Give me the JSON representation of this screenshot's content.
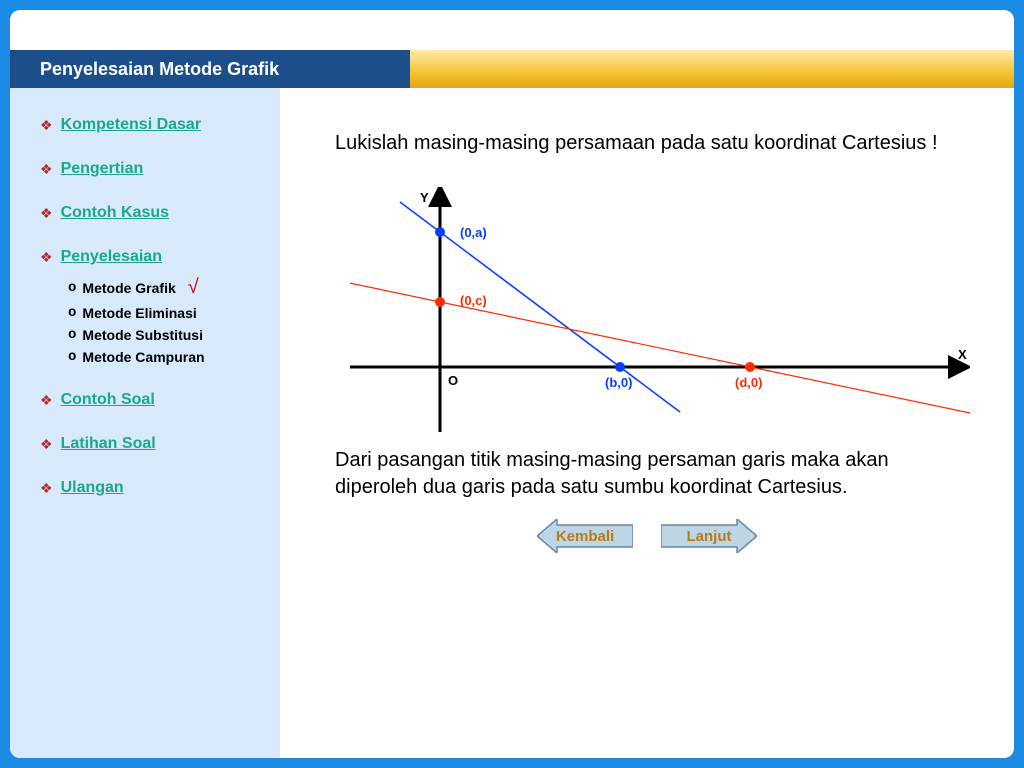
{
  "header": {
    "title": "Penyelesaian Metode Grafik"
  },
  "sidebar": {
    "items": [
      {
        "label": "Kompetensi Dasar"
      },
      {
        "label": "Pengertian"
      },
      {
        "label": "Contoh Kasus"
      },
      {
        "label": "Penyelesaian",
        "sub": [
          {
            "label": "Metode Grafik",
            "active": true
          },
          {
            "label": "Metode Eliminasi"
          },
          {
            "label": "Metode Substitusi"
          },
          {
            "label": "Metode Campuran"
          }
        ]
      },
      {
        "label": "Contoh Soal"
      },
      {
        "label": "Latihan Soal"
      },
      {
        "label": "Ulangan"
      }
    ]
  },
  "main": {
    "lead": "Lukislah masing-masing persamaan pada satu koordinat Cartesius !",
    "body": "Dari pasangan titik masing-masing persaman garis maka akan diperoleh dua garis pada satu sumbu koordinat Cartesius."
  },
  "buttons": {
    "back": "Kembali",
    "next": "Lanjut"
  },
  "chart_data": {
    "type": "line",
    "title": "",
    "xlabel": "X",
    "ylabel": "Y",
    "origin_label": "O",
    "series": [
      {
        "name": "line1",
        "color": "#0a3cff",
        "points": [
          {
            "label": "(0,a)",
            "x": 0,
            "y": "a"
          },
          {
            "label": "(b,0)",
            "x": "b",
            "y": 0
          }
        ]
      },
      {
        "name": "line2",
        "color": "#ff2a00",
        "points": [
          {
            "label": "(0,c)",
            "x": 0,
            "y": "c"
          },
          {
            "label": "(d,0)",
            "x": "d",
            "y": 0
          }
        ]
      }
    ],
    "annotations": [
      "(0,a)",
      "(0,c)",
      "(b,0)",
      "(d,0)"
    ]
  }
}
